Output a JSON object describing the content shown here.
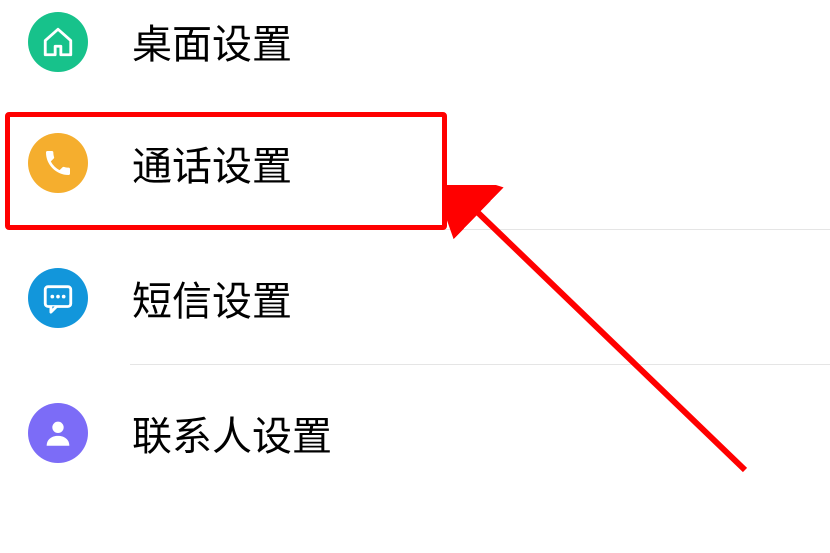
{
  "settings": {
    "items": [
      {
        "icon_name": "home-icon",
        "icon_bg": "#17c28b",
        "label": "桌面设置"
      },
      {
        "icon_name": "phone-icon",
        "icon_bg": "#f5ae2e",
        "label": "通话设置"
      },
      {
        "icon_name": "sms-icon",
        "icon_bg": "#1296db",
        "label": "短信设置"
      },
      {
        "icon_name": "contact-icon",
        "icon_bg": "#7c6cf7",
        "label": "联系人设置"
      }
    ]
  },
  "annotation": {
    "highlighted_item_index": 1,
    "highlight_color": "#ff0000",
    "arrow_color": "#ff0000"
  }
}
